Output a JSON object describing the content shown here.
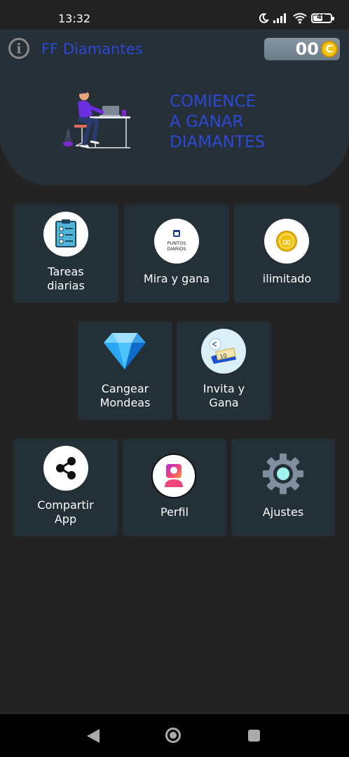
{
  "status_bar": {
    "time": "13:32",
    "battery": "49"
  },
  "app_bar": {
    "title": "FF Diamantes",
    "coins": "00",
    "coin_symbol": "C"
  },
  "banner": {
    "line1": "COMIENCE",
    "line2": "A GANAR",
    "line3": "DIAMANTES"
  },
  "menu": {
    "row1": [
      {
        "label": "Tareas diarias",
        "icon": "clipboard-icon"
      },
      {
        "label": "Mira y gana",
        "icon": "puntos-diarios-icon",
        "icon_text_1": "PUNTOS",
        "icon_text_2": "DIARIOS"
      },
      {
        "label": "ilimitado",
        "icon": "infinity-coin-icon",
        "icon_text": "∞"
      }
    ],
    "row2": [
      {
        "label": "Cangear Mondeas",
        "icon": "diamond-icon"
      },
      {
        "label": "Invita y Gana",
        "icon": "invite-ticket-icon",
        "icon_text": "10"
      }
    ],
    "row3": [
      {
        "label": "Compartir App",
        "icon": "share-icon"
      },
      {
        "label": "Perfil",
        "icon": "profile-icon"
      },
      {
        "label": "Ajustes",
        "icon": "gear-icon"
      }
    ]
  },
  "colors": {
    "accent": "#2d49d3",
    "card": "#243038",
    "background": "#232323"
  }
}
